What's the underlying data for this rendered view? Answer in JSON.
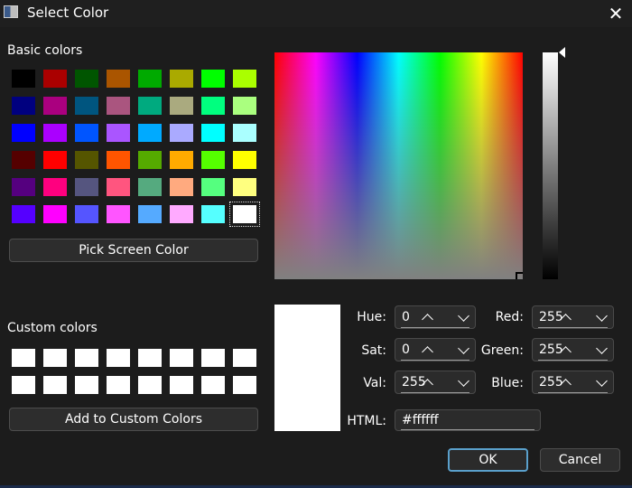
{
  "window": {
    "title": "Select Color",
    "close_icon": "close-icon"
  },
  "basic": {
    "label": "Basic colors",
    "swatches": [
      "#000000",
      "#aa0000",
      "#005500",
      "#aa5500",
      "#00aa00",
      "#aaaa00",
      "#00ff00",
      "#aaff00",
      "#00007f",
      "#aa007f",
      "#00557f",
      "#aa557f",
      "#00aa7f",
      "#aaaa7f",
      "#00ff7f",
      "#aaff7f",
      "#0000ff",
      "#aa00ff",
      "#0055ff",
      "#aa55ff",
      "#00aaff",
      "#aaaaff",
      "#00ffff",
      "#aaffff",
      "#550000",
      "#ff0000",
      "#555500",
      "#ff5500",
      "#55aa00",
      "#ffaa00",
      "#55ff00",
      "#ffff00",
      "#55007f",
      "#ff007f",
      "#55557f",
      "#ff557f",
      "#55aa7f",
      "#ffaa7f",
      "#55ff7f",
      "#ffff7f",
      "#5500ff",
      "#ff00ff",
      "#5555ff",
      "#ff55ff",
      "#55aaff",
      "#ffaaff",
      "#55ffff",
      "#ffffff"
    ],
    "selected_index": 47
  },
  "pick_screen_label": "Pick Screen Color",
  "custom": {
    "label": "Custom colors",
    "count": 16,
    "add_label": "Add to Custom Colors"
  },
  "fields": {
    "hue": {
      "label": "Hue:",
      "value": "0"
    },
    "sat": {
      "label": "Sat:",
      "value": "0"
    },
    "val": {
      "label": "Val:",
      "value": "255"
    },
    "red": {
      "label": "Red:",
      "value": "255"
    },
    "green": {
      "label": "Green:",
      "value": "255"
    },
    "blue": {
      "label": "Blue:",
      "value": "255"
    },
    "html": {
      "label": "HTML:",
      "value": "#ffffff"
    }
  },
  "current_color": "#ffffff",
  "buttons": {
    "ok": "OK",
    "cancel": "Cancel"
  }
}
